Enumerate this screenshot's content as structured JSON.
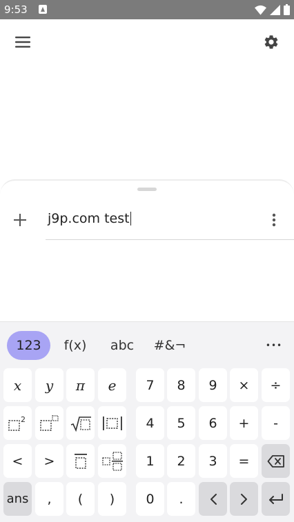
{
  "status_bar": {
    "time": "9:53"
  },
  "sheet": {
    "input_value": "j9p.com test"
  },
  "keyboard": {
    "tabs": [
      "123",
      "f(x)",
      "abc",
      "#&¬"
    ],
    "overflow": "•••",
    "rows": [
      [
        "x",
        "y",
        "π",
        "e",
        "7",
        "8",
        "9",
        "×",
        "÷"
      ],
      [
        "",
        "",
        "",
        "",
        "4",
        "5",
        "6",
        "+",
        "-"
      ],
      [
        "<",
        ">",
        "",
        "",
        "1",
        "2",
        "3",
        "=",
        ""
      ],
      [
        "ans",
        ",",
        "(",
        ")",
        "0",
        ".",
        "",
        "",
        ""
      ]
    ]
  },
  "icons": {
    "menu": "hamburger-menu-icon",
    "settings": "gear-icon",
    "add": "plus-icon",
    "more": "more-vert-icon",
    "backspace": "backspace-icon",
    "left": "chevron-left-icon",
    "right": "chevron-right-icon",
    "enter": "enter-icon"
  },
  "colors": {
    "status_bar": "#7b7b7b",
    "active_tab": "#a8a4f4",
    "key_bg": "#ffffff",
    "dark_key_bg": "#dadadd",
    "keyboard_bg": "#f3f3f5"
  }
}
